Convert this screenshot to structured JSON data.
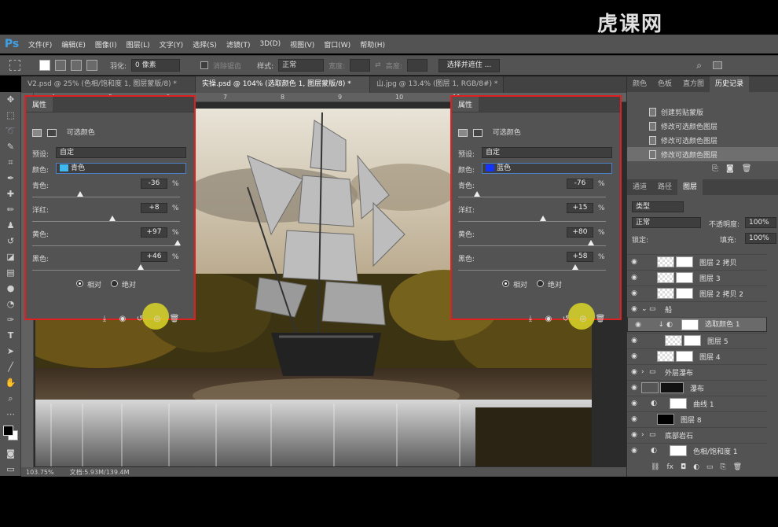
{
  "watermark": "虎课网",
  "app_logo": "Ps",
  "menu": [
    "文件(F)",
    "编辑(E)",
    "图像(I)",
    "图层(L)",
    "文字(Y)",
    "选择(S)",
    "滤镜(T)",
    "3D(D)",
    "视图(V)",
    "窗口(W)",
    "帮助(H)"
  ],
  "options": {
    "feather_label": "羽化:",
    "feather_value": "0 像素",
    "antialias_label": "消除锯齿",
    "style_label": "样式:",
    "style_value": "正常",
    "width_label": "宽度:",
    "height_label": "高度:",
    "select_mask_button": "选择并遮住 ..."
  },
  "tabs": [
    "V2.psd @ 25% (色相/饱和度 1, 图层蒙版/8) *",
    "实操.psd @ 104% (选取颜色 1, 图层蒙版/8) *",
    "山.jpg @ 13.4% (图层 1, RGB/8#) *"
  ],
  "ruler_marks": [
    "4",
    "5",
    "6",
    "7",
    "8",
    "9",
    "10",
    "11"
  ],
  "status": {
    "zoom": "103.75%",
    "doc": "文档:5.93M/139.4M"
  },
  "panel_left": {
    "title": "属性",
    "type": "可选颜色",
    "preset_label": "预设:",
    "preset_value": "自定",
    "color_label": "颜色:",
    "color_value": "青色",
    "color_swatch": "#3fb8f0",
    "sliders": [
      {
        "label": "青色:",
        "value": "-36"
      },
      {
        "label": "洋红:",
        "value": "+8"
      },
      {
        "label": "黄色:",
        "value": "+97"
      },
      {
        "label": "黑色:",
        "value": "+46"
      }
    ],
    "pct": "%",
    "relative": "相对",
    "absolute": "绝对"
  },
  "panel_right": {
    "title": "属性",
    "type": "可选颜色",
    "preset_label": "预设:",
    "preset_value": "自定",
    "color_label": "颜色:",
    "color_value": "蓝色",
    "color_swatch": "#1433ff",
    "sliders": [
      {
        "label": "青色:",
        "value": "-76"
      },
      {
        "label": "洋红:",
        "value": "+15"
      },
      {
        "label": "黄色:",
        "value": "+80"
      },
      {
        "label": "黑色:",
        "value": "+58"
      }
    ],
    "pct": "%",
    "relative": "相对",
    "absolute": "绝对"
  },
  "right_top_tabs": [
    "颜色",
    "色板",
    "直方图",
    "历史记录"
  ],
  "history": [
    "创建剪贴蒙版",
    "修改可选颜色图层",
    "修改可选颜色图层",
    "修改可选颜色图层"
  ],
  "layer_tabs": [
    "通道",
    "路径",
    "图层"
  ],
  "layer_filter": "类型",
  "blend_mode": "正常",
  "opacity_label": "不透明度:",
  "opacity_value": "100%",
  "lock_label": "锁定:",
  "fill_label": "填充:",
  "fill_value": "100%",
  "layers": [
    "图层 2 拷贝",
    "图层 3",
    "图层 2 拷贝 2",
    "船",
    "选取颜色 1",
    "图层 5",
    "图层 4",
    "外层瀑布",
    "瀑布",
    "曲线 1",
    "图层 8",
    "底部岩石",
    "色相/饱和度 1"
  ]
}
